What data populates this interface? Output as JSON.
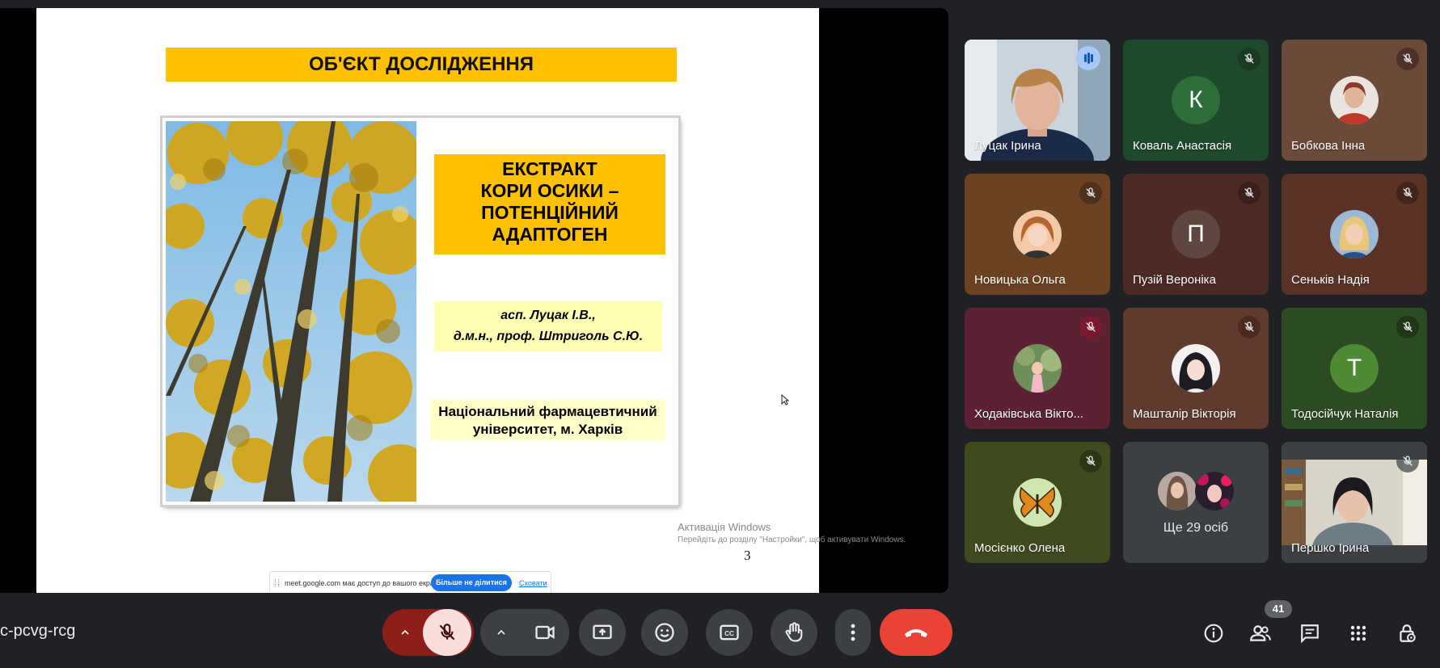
{
  "slide": {
    "title": "ОБ'ЄКТ ДОСЛІДЖЕННЯ",
    "extract_lines": [
      "ЕКСТРАКТ",
      "КОРИ ОСИКИ –",
      "ПОТЕНЦІЙНИЙ",
      "АДАПТОГЕН"
    ],
    "authors_lines": [
      "асп. Луцак І.В.,",
      "д.м.н., проф. Штриголь С.Ю."
    ],
    "university_lines": [
      "Національний фармацевтичний",
      "університет, м. Харків"
    ],
    "page_number": "3",
    "activation_title": "Активація Windows",
    "activation_sub": "Перейдіть до розділу \"Настройки\", щоб активувати Windows."
  },
  "share_bar": {
    "text": "meet.google.com має доступ до вашого екрана.",
    "stop_label": "Більше не ділитися",
    "hide_label": "Сховати"
  },
  "participants": [
    {
      "name": "Луцак Ірина",
      "kind": "video",
      "status": "speaking"
    },
    {
      "name": "Коваль Анастасія",
      "kind": "letter",
      "letter": "К",
      "bg": "#1e4a2c",
      "avatar_bg": "#2f6d3b",
      "status": "muted"
    },
    {
      "name": "Бобкова Інна",
      "kind": "photo",
      "bg": "#6b4a3a",
      "status": "muted"
    },
    {
      "name": "Новицька Ольга",
      "kind": "photo",
      "bg": "#6b4322",
      "status": "muted"
    },
    {
      "name": "Пузій Вероніка",
      "kind": "letter",
      "letter": "П",
      "bg": "#4e2a24",
      "avatar_bg": "#5d4740",
      "status": "muted"
    },
    {
      "name": "Сеньків Надія",
      "kind": "photo",
      "bg": "#5a3326",
      "status": "muted"
    },
    {
      "name": "Ходаківська Вікто...",
      "kind": "photo",
      "bg": "#5c2233",
      "status": "muted"
    },
    {
      "name": "Машталір Вікторія",
      "kind": "photo",
      "bg": "#5f3a2e",
      "status": "muted"
    },
    {
      "name": "Тодосійчук Наталія",
      "kind": "letter",
      "letter": "Т",
      "bg": "#2d4b22",
      "avatar_bg": "#4f8a35",
      "status": "muted"
    },
    {
      "name": "Мосієнко Олена",
      "kind": "photo",
      "bg": "#3f4a1e",
      "status": "muted"
    },
    {
      "name": "Ще 29 осіб",
      "kind": "more",
      "bg": "#3c4043",
      "status": "none"
    },
    {
      "name": "Першко Ірина",
      "kind": "video",
      "status": "muted"
    }
  ],
  "toolbar": {
    "meeting_code": "c-pcvg-rcg",
    "people_count": "41"
  },
  "colors": {
    "slide_accent": "#ffc000",
    "hangup": "#ea4335",
    "mic_off": "#f9dedc",
    "mic_caret_bg": "#8c1d18"
  },
  "icons": [
    "chevron-up-icon",
    "mic-off-icon",
    "camera-icon",
    "present-icon",
    "emoji-icon",
    "captions-icon",
    "raise-hand-icon",
    "more-vert-icon",
    "hangup-icon",
    "info-icon",
    "people-icon",
    "chat-icon",
    "apps-icon",
    "host-controls-icon"
  ]
}
